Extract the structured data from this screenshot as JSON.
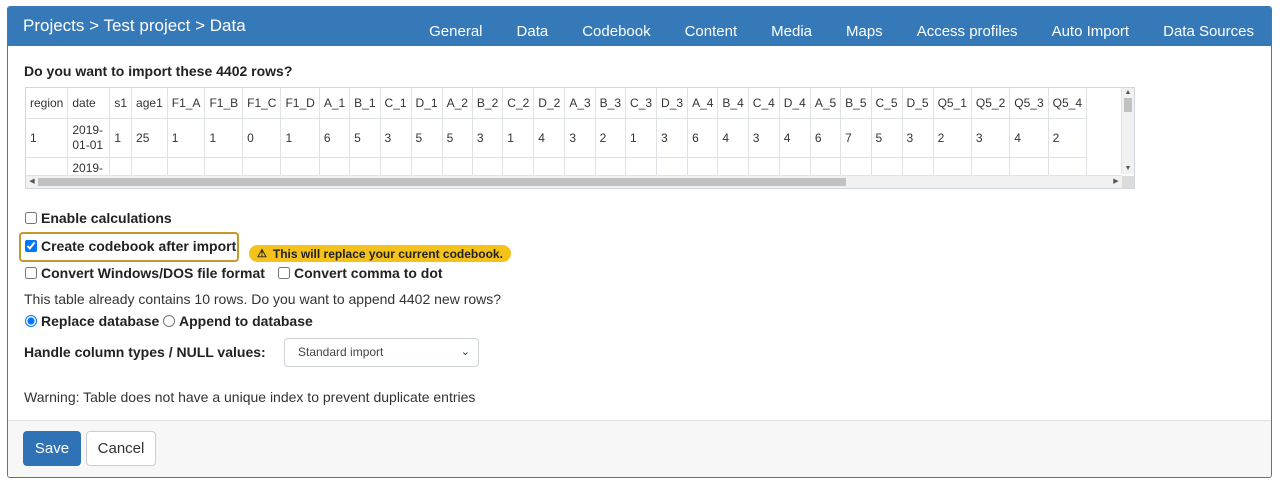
{
  "header": {
    "breadcrumb": "Projects > Test project > Data",
    "nav": [
      "General",
      "Data",
      "Codebook",
      "Content",
      "Media",
      "Maps",
      "Access profiles",
      "Auto Import",
      "Data Sources"
    ]
  },
  "question": "Do you want to import these 4402 rows?",
  "preview": {
    "columns": [
      "region",
      "date",
      "s1",
      "age1",
      "F1_A",
      "F1_B",
      "F1_C",
      "F1_D",
      "A_1",
      "B_1",
      "C_1",
      "D_1",
      "A_2",
      "B_2",
      "C_2",
      "D_2",
      "A_3",
      "B_3",
      "C_3",
      "D_3",
      "A_4",
      "B_4",
      "C_4",
      "D_4",
      "A_5",
      "B_5",
      "C_5",
      "D_5",
      "Q5_1",
      "Q5_2",
      "Q5_3",
      "Q5_4"
    ],
    "row1": [
      "1",
      "2019-01-01",
      "1",
      "25",
      "1",
      "1",
      "0",
      "1",
      "6",
      "5",
      "3",
      "5",
      "5",
      "3",
      "1",
      "4",
      "3",
      "2",
      "1",
      "3",
      "6",
      "4",
      "3",
      "4",
      "6",
      "7",
      "5",
      "3",
      "2",
      "3",
      "4",
      "2"
    ],
    "row2_date": "2019-"
  },
  "options": {
    "enable_calculations": "Enable calculations",
    "create_codebook": "Create codebook after import",
    "codebook_warning": "This will replace your current codebook.",
    "convert_windows": "Convert Windows/DOS file format",
    "convert_comma": "Convert comma to dot",
    "append_question": "This table already contains 10 rows. Do you want to append 4402 new rows?",
    "replace_db": "Replace database",
    "append_db": "Append to database",
    "handle_label": "Handle column types / NULL values:",
    "handle_selected": "Standard import",
    "index_warning": "Warning: Table does not have a unique index to prevent duplicate entries"
  },
  "footer": {
    "save": "Save",
    "cancel": "Cancel"
  },
  "colors": {
    "header": "#3579b9",
    "badge": "#f5c11b",
    "highlight_border": "#c39a28",
    "save": "#2f73b6"
  }
}
